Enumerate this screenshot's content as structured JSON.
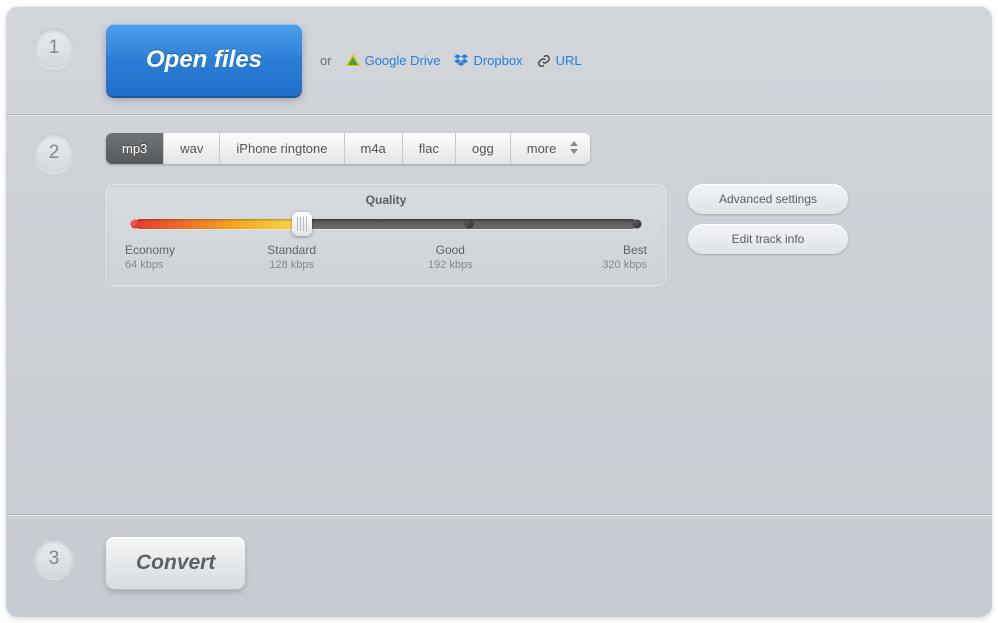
{
  "step1": {
    "open_label": "Open files",
    "or_label": "or",
    "gdrive_label": "Google Drive",
    "dropbox_label": "Dropbox",
    "url_label": "URL"
  },
  "step2": {
    "tabs": {
      "mp3": "mp3",
      "wav": "wav",
      "iphone": "iPhone ringtone",
      "m4a": "m4a",
      "flac": "flac",
      "ogg": "ogg",
      "more": "more"
    },
    "quality": {
      "title": "Quality",
      "levels": [
        {
          "name": "Economy",
          "rate": "64 kbps"
        },
        {
          "name": "Standard",
          "rate": "128 kbps"
        },
        {
          "name": "Good",
          "rate": "192 kbps"
        },
        {
          "name": "Best",
          "rate": "320 kbps"
        }
      ]
    },
    "advanced_label": "Advanced settings",
    "trackinfo_label": "Edit track info"
  },
  "step3": {
    "convert_label": "Convert"
  },
  "nums": {
    "s1": "1",
    "s2": "2",
    "s3": "3"
  }
}
